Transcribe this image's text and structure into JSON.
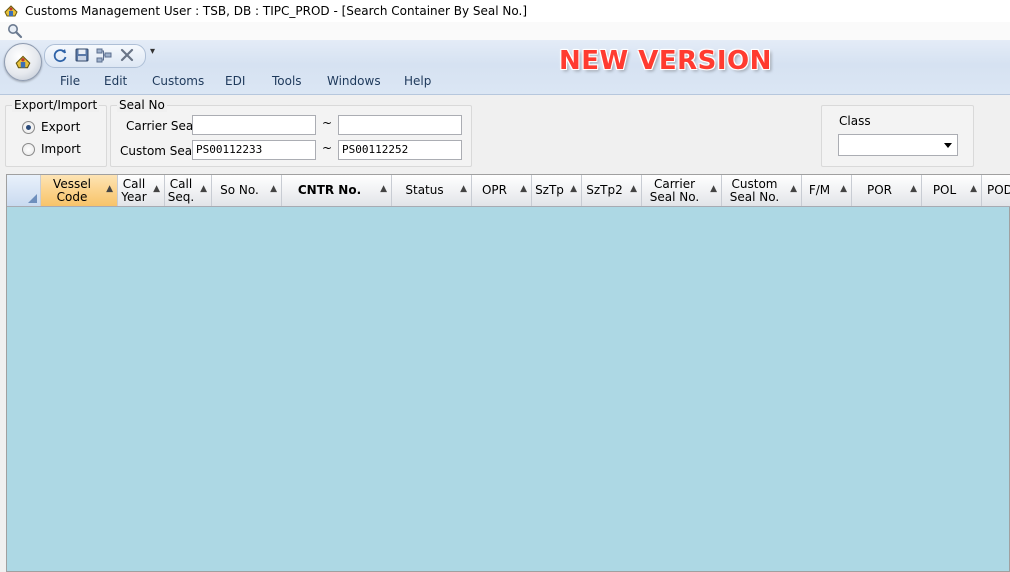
{
  "window": {
    "title": "Customs Management User : TSB, DB : TIPC_PROD - [Search Container By Seal No.]",
    "app_icon": "customs-app-icon"
  },
  "search_strip": {
    "icon": "magnifier-icon"
  },
  "quick_access": {
    "icons": [
      "refresh-icon",
      "save-icon",
      "tree-icon",
      "close-icon"
    ],
    "more_label": "▾"
  },
  "menu": {
    "items": [
      "File",
      "Edit",
      "Customs",
      "EDI",
      "Tools",
      "Windows",
      "Help"
    ]
  },
  "banner": {
    "text": "NEW VERSION",
    "color": "#ff3b30"
  },
  "export_import": {
    "title": "Export/Import",
    "options": [
      {
        "label": "Export",
        "selected": true
      },
      {
        "label": "Import",
        "selected": false
      }
    ]
  },
  "seal_no": {
    "title": "Seal No",
    "carrier_label": "Carrier Seal",
    "carrier_from": "",
    "carrier_to": "",
    "custom_label": "Custom Seal",
    "custom_from": "PS00112233",
    "custom_to": "PS00112252",
    "range_separator": "~"
  },
  "class_filter": {
    "title": "Class",
    "selected": ""
  },
  "grid": {
    "background": "#add8e4",
    "columns": [
      {
        "label": "Vessel\nCode",
        "active": true
      },
      {
        "label": "Call\nYear"
      },
      {
        "label": "Call\nSeq."
      },
      {
        "label": "So No."
      },
      {
        "label": "CNTR No.",
        "bold": true
      },
      {
        "label": "Status"
      },
      {
        "label": "OPR"
      },
      {
        "label": "SzTp"
      },
      {
        "label": "SzTp2"
      },
      {
        "label": "Carrier\nSeal No."
      },
      {
        "label": "Custom\nSeal No."
      },
      {
        "label": "F/M"
      },
      {
        "label": "POR"
      },
      {
        "label": "POL"
      },
      {
        "label": "POD"
      }
    ],
    "sort_glyph": "▲",
    "rows": []
  }
}
